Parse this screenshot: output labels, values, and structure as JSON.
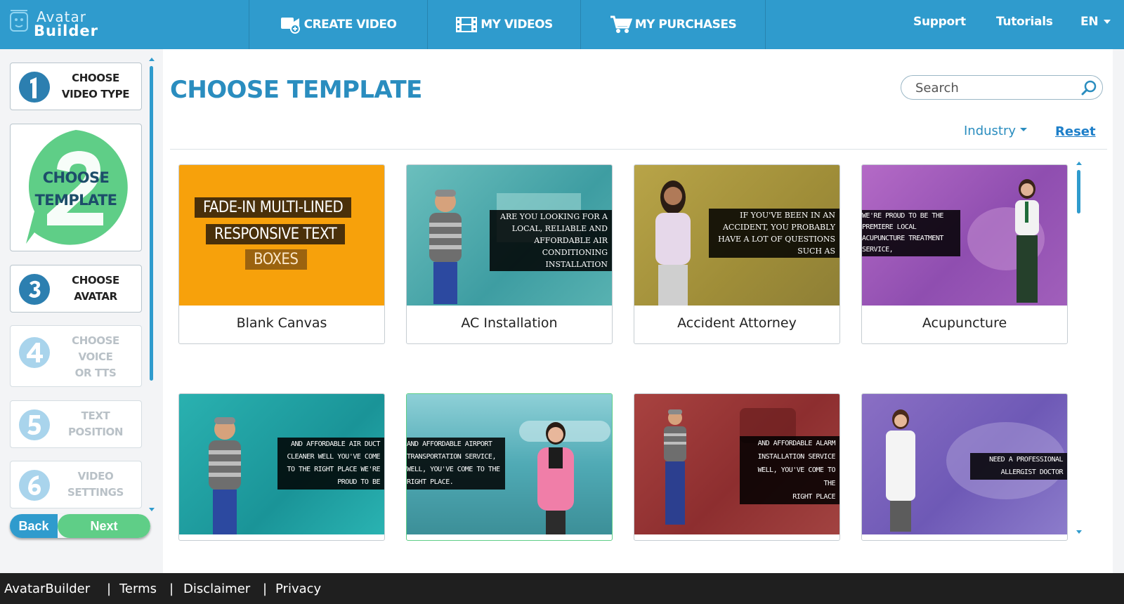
{
  "header": {
    "logo_line1": "Avatar",
    "logo_line2": "Builder",
    "nav": [
      {
        "label": "CREATE VIDEO",
        "icon": "video-plus-icon"
      },
      {
        "label": "MY VIDEOS",
        "icon": "film-icon"
      },
      {
        "label": "MY PURCHASES",
        "icon": "cart-icon"
      }
    ],
    "support": "Support",
    "tutorials": "Tutorials",
    "language": "EN"
  },
  "sidebar": {
    "steps": [
      {
        "line1": "CHOOSE",
        "line2": "VIDEO TYPE",
        "number": "1",
        "state": "done"
      },
      {
        "line1": "CHOOSE",
        "line2": "TEMPLATE",
        "number": "2",
        "state": "active"
      },
      {
        "line1": "CHOOSE",
        "line2": "AVATAR",
        "number": "3",
        "state": "done"
      },
      {
        "line1": "CHOOSE",
        "line2": "VOICE",
        "line3": "OR TTS",
        "number": "4",
        "state": "disabled"
      },
      {
        "line1": "TEXT",
        "line2": "POSITION",
        "number": "5",
        "state": "disabled"
      },
      {
        "line1": "VIDEO",
        "line2": "SETTINGS",
        "number": "6",
        "state": "disabled"
      }
    ],
    "back_label": "Back",
    "next_label": "Next"
  },
  "main": {
    "title": "CHOOSE TEMPLATE",
    "search_placeholder": "Search",
    "industry_label": "Industry",
    "reset_label": "Reset",
    "templates": [
      {
        "name": "Blank Canvas",
        "thumb_lines": [
          "FADE-IN MULTI-LINED",
          "RESPONSIVE TEXT",
          "BOXES"
        ]
      },
      {
        "name": "AC Installation",
        "thumb_lines": [
          "ARE YOU LOOKING FOR A",
          "LOCAL, RELIABLE AND",
          "AFFORDABLE AIR",
          "CONDITIONING INSTALLATION"
        ]
      },
      {
        "name": "Accident Attorney",
        "thumb_lines": [
          "IF YOU'VE BEEN IN AN",
          "ACCIDENT, YOU PROBABLY",
          "HAVE A LOT OF QUESTIONS",
          "SUCH AS"
        ]
      },
      {
        "name": "Acupuncture",
        "thumb_lines": [
          "WE'RE PROUD TO BE THE",
          "PREMIERE LOCAL",
          "ACUPUNCTURE TREATMENT",
          "SERVICE,"
        ]
      },
      {
        "name": "",
        "thumb_lines": [
          "AND AFFORDABLE AIR DUCT",
          "CLEANER WELL YOU'VE COME",
          "TO THE RIGHT PLACE WE'RE",
          "PROUD TO BE"
        ]
      },
      {
        "name": "",
        "thumb_lines": [
          "AND AFFORDABLE AIRPORT",
          "TRANSPORTATION SERVICE,",
          "WELL, YOU'VE COME TO THE",
          "RIGHT PLACE."
        ]
      },
      {
        "name": "",
        "thumb_lines": [
          "AND AFFORDABLE ALARM",
          "INSTALLATION SERVICE",
          "WELL, YOU'VE COME TO THE",
          "RIGHT PLACE"
        ]
      },
      {
        "name": "",
        "thumb_lines": [
          "NEED A PROFESSIONAL",
          "ALLERGIST DOCTOR"
        ]
      }
    ]
  },
  "footer": {
    "brand": "AvatarBuilder",
    "terms": "Terms",
    "disclaimer": "Disclaimer",
    "privacy": "Privacy"
  },
  "colors": {
    "header_bg": "#2f9bcd",
    "accent": "#2a8dbf",
    "next_green": "#5fce87",
    "footer_bg": "#1f1f1f"
  }
}
